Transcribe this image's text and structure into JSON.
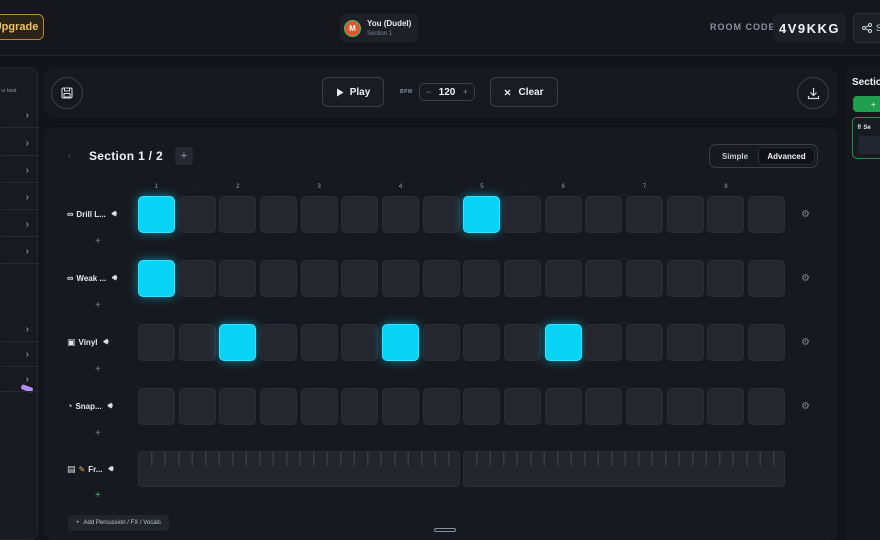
{
  "header": {
    "upgrade_label": "Upgrade",
    "user_initial": "M",
    "user_name": "You (Dudel)",
    "user_section": "Section 1",
    "room_code_label": "ROOM CODE:",
    "room_code": "4V9KKG",
    "share_label": "S"
  },
  "left_sidebar": {
    "hint": "ur beat",
    "chevron": "›"
  },
  "toolbar": {
    "play_label": "Play",
    "bpm_label": "BPM",
    "bpm_minus": "−",
    "bpm_value": "120",
    "bpm_plus": "+",
    "clear_label": "Clear"
  },
  "sequencer": {
    "prev_arrow": "‹",
    "section_title": "Section 1 / 2",
    "add_section": "+",
    "mode_simple": "Simple",
    "mode_advanced": "Advanced",
    "beat_markers": [
      "1",
      "·",
      "2",
      "·",
      "3",
      "·",
      "4",
      "·",
      "5",
      "·",
      "6",
      "·",
      "7",
      "·",
      "8",
      "·"
    ],
    "tracks": [
      {
        "icon": "∞",
        "name": "Drill L...",
        "steps": [
          1,
          0,
          0,
          0,
          0,
          0,
          0,
          0,
          1,
          0,
          0,
          0,
          0,
          0,
          0,
          0
        ]
      },
      {
        "icon": "∞",
        "name": "Weak ...",
        "steps": [
          1,
          0,
          0,
          0,
          0,
          0,
          0,
          0,
          0,
          0,
          0,
          0,
          0,
          0,
          0,
          0
        ]
      },
      {
        "icon": "▣",
        "name": "Vinyl",
        "steps": [
          0,
          0,
          1,
          0,
          0,
          0,
          1,
          0,
          0,
          0,
          1,
          0,
          0,
          0,
          0,
          0
        ]
      },
      {
        "icon": "◔",
        "name": "Snap...",
        "steps": [
          0,
          0,
          0,
          0,
          0,
          0,
          0,
          0,
          0,
          0,
          0,
          0,
          0,
          0,
          0,
          0
        ]
      }
    ],
    "instrument_track": {
      "icon": "▤",
      "name": "Fr..."
    },
    "add_track_label": "Add Percussion / FX / Vocals"
  },
  "right_panel": {
    "title": "Sections",
    "add_label": "+",
    "card_label": "Se"
  },
  "colors": {
    "active_step": "#0ad4f5",
    "inactive_step": "#25272e",
    "upgrade_accent": "#f0c25c",
    "add_green": "#1f9e4f"
  }
}
